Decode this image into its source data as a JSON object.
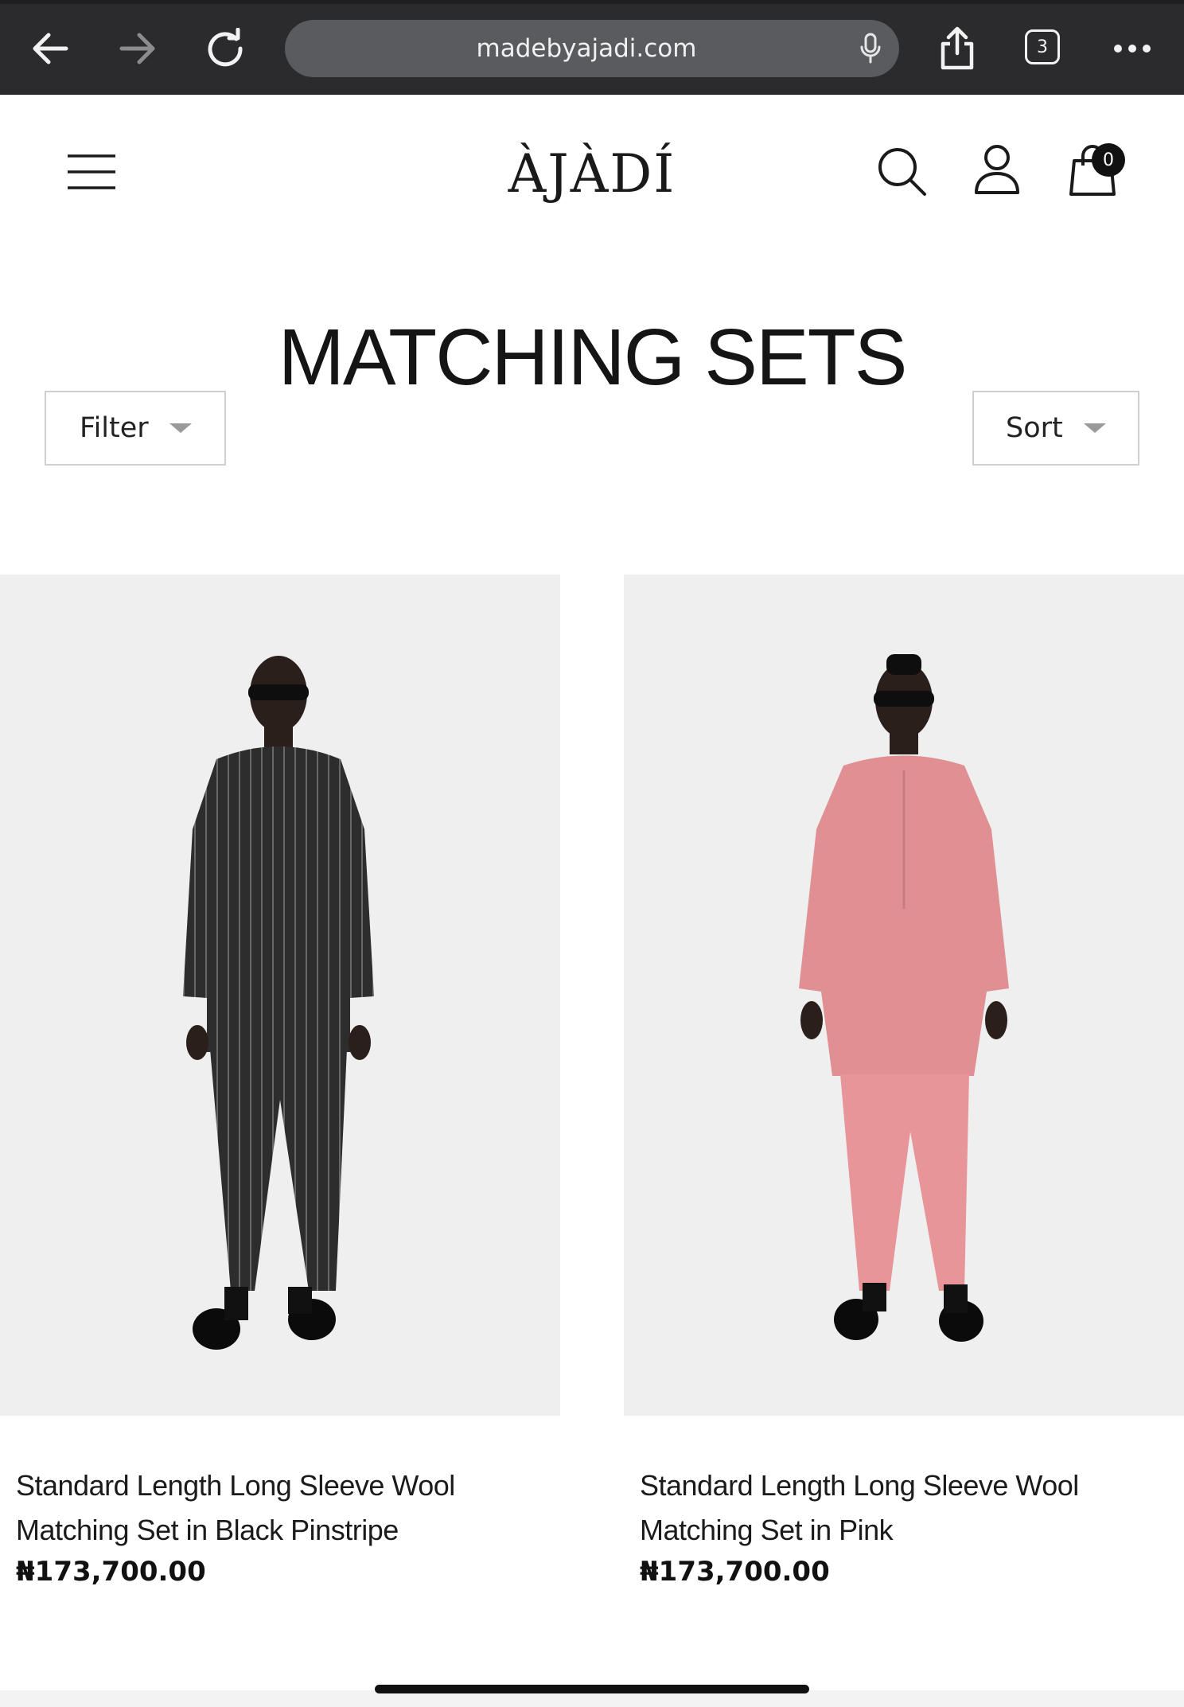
{
  "browser": {
    "url": "madebyajadi.com",
    "tab_count": "3",
    "icons": [
      "back-arrow-icon",
      "forward-arrow-icon",
      "reload-icon",
      "microphone-icon",
      "share-icon",
      "tabs-icon",
      "more-icon"
    ]
  },
  "header": {
    "logo": "ÀJÀDÍ",
    "cart_count": "0",
    "icons": [
      "hamburger-menu-icon",
      "search-icon",
      "account-icon",
      "shopping-bag-icon"
    ]
  },
  "page": {
    "title": "MATCHING SETS",
    "filter_label": "Filter",
    "sort_label": "Sort"
  },
  "products": [
    {
      "name": "Standard Length Long Sleeve Wool Matching Set in Black Pinstripe",
      "price": "₦173,700.00",
      "color": "#2e2d2d"
    },
    {
      "name": "Standard Length Long Sleeve Wool Matching Set in Pink",
      "price": "₦173,700.00",
      "color": "#e08f93"
    }
  ]
}
